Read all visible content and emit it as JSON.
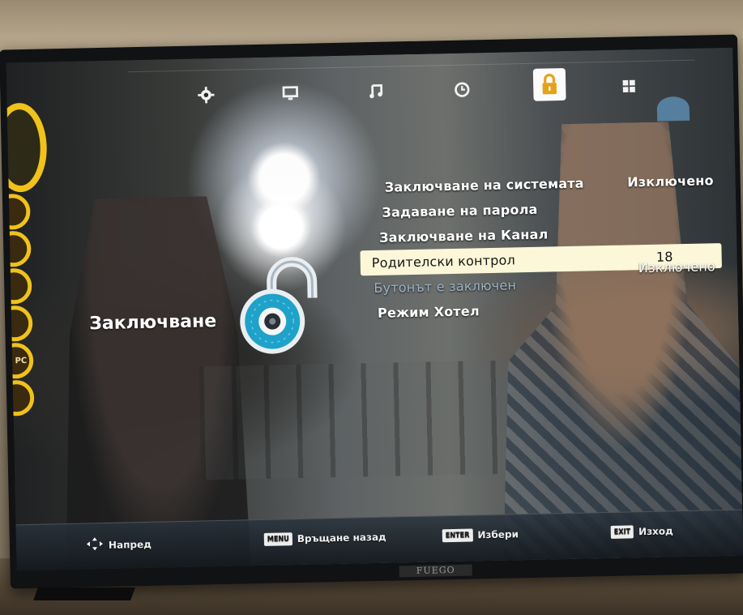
{
  "top_menu": {
    "tabs": [
      {
        "icon": "gear-icon",
        "glyph": "⚙"
      },
      {
        "icon": "monitor-icon",
        "glyph": "🖵"
      },
      {
        "icon": "music-note-icon",
        "glyph": "♫"
      },
      {
        "icon": "clock-icon",
        "glyph": "◷"
      },
      {
        "icon": "padlock-icon",
        "glyph": "🔒",
        "active": true
      },
      {
        "icon": "grid-icon",
        "glyph": "▦"
      }
    ]
  },
  "section": {
    "title": "Заключване"
  },
  "menu": {
    "items": [
      {
        "label": "Заключване на системата",
        "value": "Изключено"
      },
      {
        "label": "Задаване на парола",
        "value": ""
      },
      {
        "label": "Заключване на Канал",
        "value": ""
      },
      {
        "label": "Родителски контрол",
        "value": "18",
        "selected": true
      },
      {
        "label": "Бутонът е заключен",
        "value": "Изключено",
        "dim": true
      },
      {
        "label": "Режим Хотел",
        "value": ""
      }
    ]
  },
  "bottom_bar": {
    "move": {
      "icon": "dpad-icon",
      "label": "Напред"
    },
    "back": {
      "key": "MENU",
      "label": "Връщане назад"
    },
    "select": {
      "key": "ENTER",
      "label": "Избери"
    },
    "exit": {
      "key": "EXIT",
      "label": "Изход"
    }
  },
  "brand": "FUEGO",
  "side_badges": [
    "",
    "",
    "",
    "",
    "",
    "PC",
    ""
  ],
  "colors": {
    "selected_bg": "#fbf7d8",
    "menu_text": "#ffffff",
    "dim_text": "#9fb3c8",
    "badge_ring": "#f0c21a",
    "lock_teal": "#1fa2c9"
  }
}
